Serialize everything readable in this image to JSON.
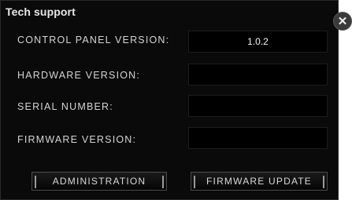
{
  "window": {
    "title": "Tech support",
    "close_glyph": "✕"
  },
  "rows": [
    {
      "label": "CONTROL PANEL VERSION:",
      "value": "1.0.2"
    },
    {
      "label": "HARDWARE VERSION:",
      "value": ""
    },
    {
      "label": "SERIAL NUMBER:",
      "value": ""
    },
    {
      "label": "FIRMWARE VERSION:",
      "value": ""
    }
  ],
  "buttons": {
    "administration": "ADMINISTRATION",
    "firmware_update": "FIRMWARE UPDATE"
  },
  "colors": {
    "background": "#0a0a0a",
    "text": "#d4d4d4",
    "field": "#000000"
  },
  "icons": {
    "close": "close-icon"
  }
}
